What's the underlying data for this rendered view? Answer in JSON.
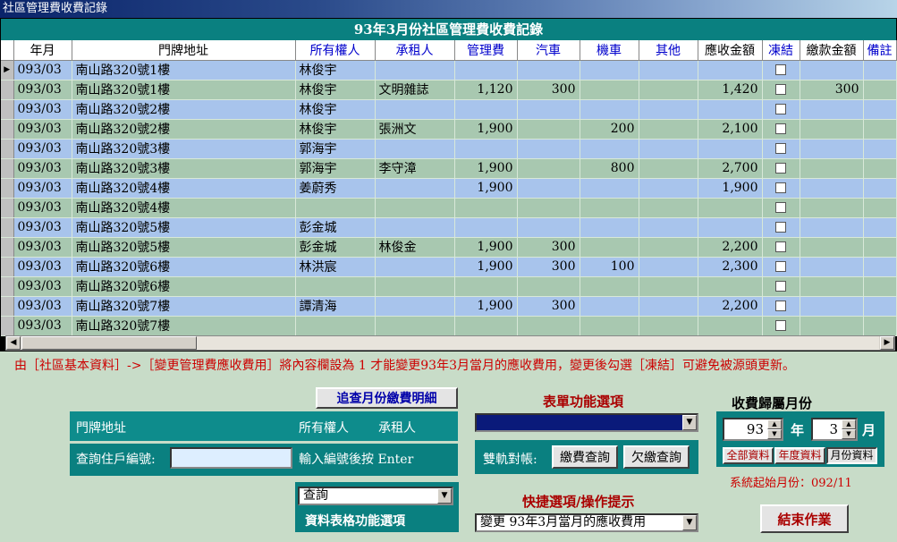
{
  "window": {
    "title": "社區管理費收費記錄"
  },
  "grid": {
    "title": "93年3月份社區管理費收費記錄",
    "columns": [
      "年月",
      "門牌地址",
      "所有權人",
      "承租人",
      "管理費",
      "汽車",
      "機車",
      "其他",
      "應收金額",
      "凍結",
      "繳款金額",
      "備註"
    ],
    "rows": [
      {
        "ym": "093/03",
        "addr": "南山路320號1樓",
        "owner": "林俊宇",
        "tenant": "",
        "fee": "",
        "car": "",
        "moto": "",
        "other": "",
        "due": "",
        "paid": "",
        "current": true
      },
      {
        "ym": "093/03",
        "addr": "南山路320號1樓",
        "owner": "林俊宇",
        "tenant": "文明雜誌",
        "fee": "1,120",
        "car": "300",
        "moto": "",
        "other": "",
        "due": "1,420",
        "paid": "300"
      },
      {
        "ym": "093/03",
        "addr": "南山路320號2樓",
        "owner": "林俊宇",
        "tenant": "",
        "fee": "",
        "car": "",
        "moto": "",
        "other": "",
        "due": "",
        "paid": ""
      },
      {
        "ym": "093/03",
        "addr": "南山路320號2樓",
        "owner": "林俊宇",
        "tenant": "張洲文",
        "fee": "1,900",
        "car": "",
        "moto": "200",
        "other": "",
        "due": "2,100",
        "paid": ""
      },
      {
        "ym": "093/03",
        "addr": "南山路320號3樓",
        "owner": "郭海宇",
        "tenant": "",
        "fee": "",
        "car": "",
        "moto": "",
        "other": "",
        "due": "",
        "paid": ""
      },
      {
        "ym": "093/03",
        "addr": "南山路320號3樓",
        "owner": "郭海宇",
        "tenant": "李守漳",
        "fee": "1,900",
        "car": "",
        "moto": "800",
        "other": "",
        "due": "2,700",
        "paid": ""
      },
      {
        "ym": "093/03",
        "addr": "南山路320號4樓",
        "owner": "姜蔚秀",
        "tenant": "",
        "fee": "1,900",
        "car": "",
        "moto": "",
        "other": "",
        "due": "1,900",
        "paid": ""
      },
      {
        "ym": "093/03",
        "addr": "南山路320號4樓",
        "owner": "",
        "tenant": "",
        "fee": "",
        "car": "",
        "moto": "",
        "other": "",
        "due": "",
        "paid": ""
      },
      {
        "ym": "093/03",
        "addr": "南山路320號5樓",
        "owner": "彭金城",
        "tenant": "",
        "fee": "",
        "car": "",
        "moto": "",
        "other": "",
        "due": "",
        "paid": ""
      },
      {
        "ym": "093/03",
        "addr": "南山路320號5樓",
        "owner": "彭金城",
        "tenant": "林俊金",
        "fee": "1,900",
        "car": "300",
        "moto": "",
        "other": "",
        "due": "2,200",
        "paid": ""
      },
      {
        "ym": "093/03",
        "addr": "南山路320號6樓",
        "owner": "林洪宸",
        "tenant": "",
        "fee": "1,900",
        "car": "300",
        "moto": "100",
        "other": "",
        "due": "2,300",
        "paid": ""
      },
      {
        "ym": "093/03",
        "addr": "南山路320號6樓",
        "owner": "",
        "tenant": "",
        "fee": "",
        "car": "",
        "moto": "",
        "other": "",
        "due": "",
        "paid": ""
      },
      {
        "ym": "093/03",
        "addr": "南山路320號7樓",
        "owner": "譚清海",
        "tenant": "",
        "fee": "1,900",
        "car": "300",
        "moto": "",
        "other": "",
        "due": "2,200",
        "paid": ""
      },
      {
        "ym": "093/03",
        "addr": "南山路320號7樓",
        "owner": "",
        "tenant": "",
        "fee": "",
        "car": "",
        "moto": "",
        "other": "",
        "due": "",
        "paid": ""
      }
    ]
  },
  "notice": "由［社區基本資料］->［變更管理費應收費用］將內容欄設為 1 才能變更93年3月當月的應收費用，變更後勾選［凍結］可避免被源頭更新。",
  "detail_button": "追查月份繳費明細",
  "lookup": {
    "addr_label": "門牌地址",
    "owner_label": "所有權人",
    "tenant_label": "承租人",
    "query_label": "查詢住戶編號:",
    "query_value": "",
    "hint": "輸入編號後按 Enter"
  },
  "grid_options": {
    "selected": "查詢",
    "label": "資料表格功能選項"
  },
  "form_options": {
    "heading": "表單功能選項",
    "selected": "",
    "reconcile_label": "雙軌對帳:",
    "fee_query_button": "繳費查詢",
    "arrears_button": "欠繳查詢"
  },
  "quick": {
    "heading": "快捷選項/操作提示",
    "selected": "變更 93年3月當月的應收費用"
  },
  "billing_month": {
    "heading": "收費歸屬月份",
    "year": "93",
    "year_unit": "年",
    "month": "3",
    "month_unit": "月",
    "tabs": [
      "全部資料",
      "年度資料",
      "月份資料"
    ],
    "start_label": "系統起始月份：092/11"
  },
  "exit_button": "結束作業"
}
